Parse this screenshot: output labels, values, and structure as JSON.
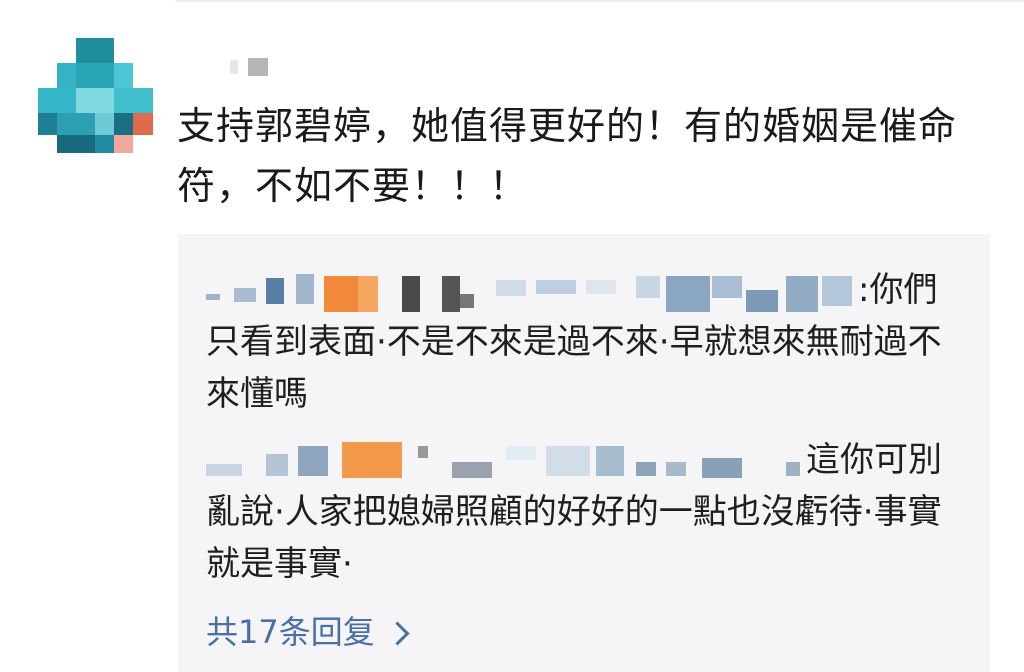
{
  "comment": {
    "text": "支持郭碧婷，她值得更好的！有的婚姻是催命符，不如不要！！！"
  },
  "replies": [
    {
      "text_after_name": ":你們只看到表面·不是不來是過不來·早就想來無耐過不來懂嗎"
    },
    {
      "text_after_name": "這你可別亂說·人家把媳婦照顧的好好的一點也沒虧待·事實就是事實·"
    }
  ],
  "more_replies": {
    "label": "共17条回复"
  },
  "colors": {
    "link": "#4a6fa5",
    "reply_bg": "#f5f5f7",
    "text": "#1a1a1a"
  },
  "icons": {
    "more_replies": "chevron-right-icon"
  }
}
